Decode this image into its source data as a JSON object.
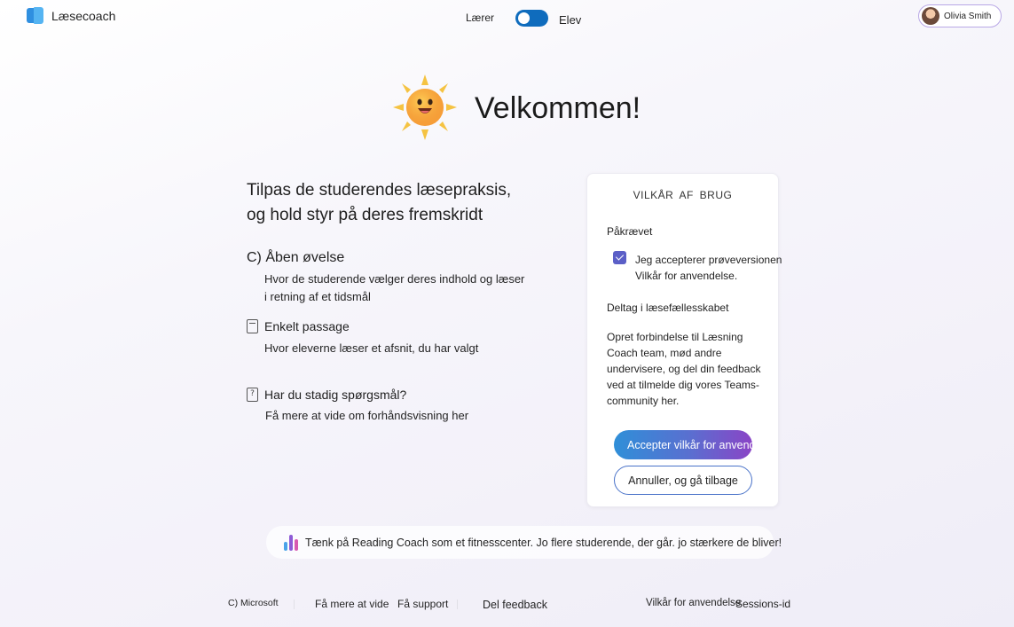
{
  "header": {
    "brand_name": "Læsecoach",
    "toggle_teacher_label": "Lærer",
    "toggle_student_label": "Elev",
    "user_name": "Olivia Smith"
  },
  "hero": {
    "title": "Velkommen!"
  },
  "intro": {
    "line1": "Tilpas de studerendes læsepraksis,",
    "line2": "og hold styr på deres fremskridt"
  },
  "modes": {
    "open_title": "C) Åben øvelse",
    "open_desc_line1": "Hvor de studerende vælger deres indhold og læser",
    "open_desc_line2": "i retning af et tidsmål",
    "single_title": "Enkelt passage",
    "single_desc": "Hvor eleverne læser et afsnit, du har valgt"
  },
  "help": {
    "title": "Har du stadig spørgsmål?",
    "desc": "Få mere at vide om forhåndsvisning her"
  },
  "terms_card": {
    "title": "VILKÅR AF BRUG",
    "required_label": "Påkrævet",
    "agree_line1": "Jeg accepterer prøveversionen",
    "agree_line2": "Vilkår for anvendelse.",
    "join_heading": "Deltag i læsefællesskabet",
    "join_body": "Opret forbindelse til Læsning Coach team, mød andre undervisere, og del din feedback ved at tilmelde dig vores Teams-community her.",
    "accept_button": "Accepter vilkår for anvendelse",
    "cancel_button": "Annuller, og gå tilbage"
  },
  "tip": {
    "text": "Tænk på Reading Coach som et fitnesscenter. Jo flere studerende, der går. jo stærkere de bliver!"
  },
  "footer": {
    "copyright": "C) Microsoft",
    "learn_more": "Få mere at vide",
    "support": "Få support",
    "feedback": "Del feedback",
    "terms": "Vilkår for anvendelse",
    "session": "Sessions-id"
  },
  "colors": {
    "toggle_on": "#0f6cbd",
    "checkbox": "#5b5fc7",
    "accept_gradient_start": "#2f8fd8",
    "accept_gradient_end": "#8a44c6",
    "cancel_border": "#4a73c9",
    "sun_body": "#f7a23a",
    "sun_rays": "#f5c342"
  },
  "icons": {
    "brand": "open-book-icon",
    "user": "avatar",
    "sun": "sun-mascot-icon",
    "single_passage": "document-icon",
    "help": "question-document-icon",
    "tip": "bar-chart-icon"
  }
}
